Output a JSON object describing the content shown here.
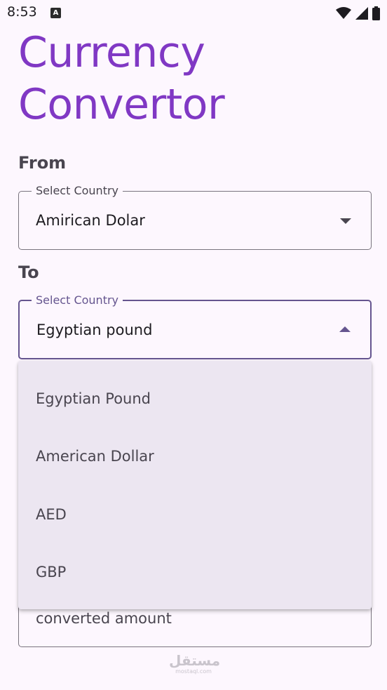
{
  "status_bar": {
    "time": "8:53",
    "notification_icon": "A",
    "icons": [
      "wifi-icon",
      "signal-icon",
      "battery-icon"
    ]
  },
  "title": "Currency Convertor",
  "from": {
    "section_label": "From",
    "field_label": "Select Country",
    "value": "Amirican Dolar"
  },
  "to": {
    "section_label": "To",
    "field_label": "Select Country",
    "value": "Egyptian pound"
  },
  "dropdown": {
    "options": [
      "Egyptian Pound",
      "American Dollar",
      "AED",
      "GBP"
    ]
  },
  "amount_field": {
    "placeholder": "converted amount"
  },
  "watermark": {
    "main": "مستقل",
    "sub": "mostaql.com"
  },
  "colors": {
    "title": "#8038c4",
    "focus": "#65558f",
    "background": "#fdf7fe",
    "menu_background": "#ece6f1"
  }
}
